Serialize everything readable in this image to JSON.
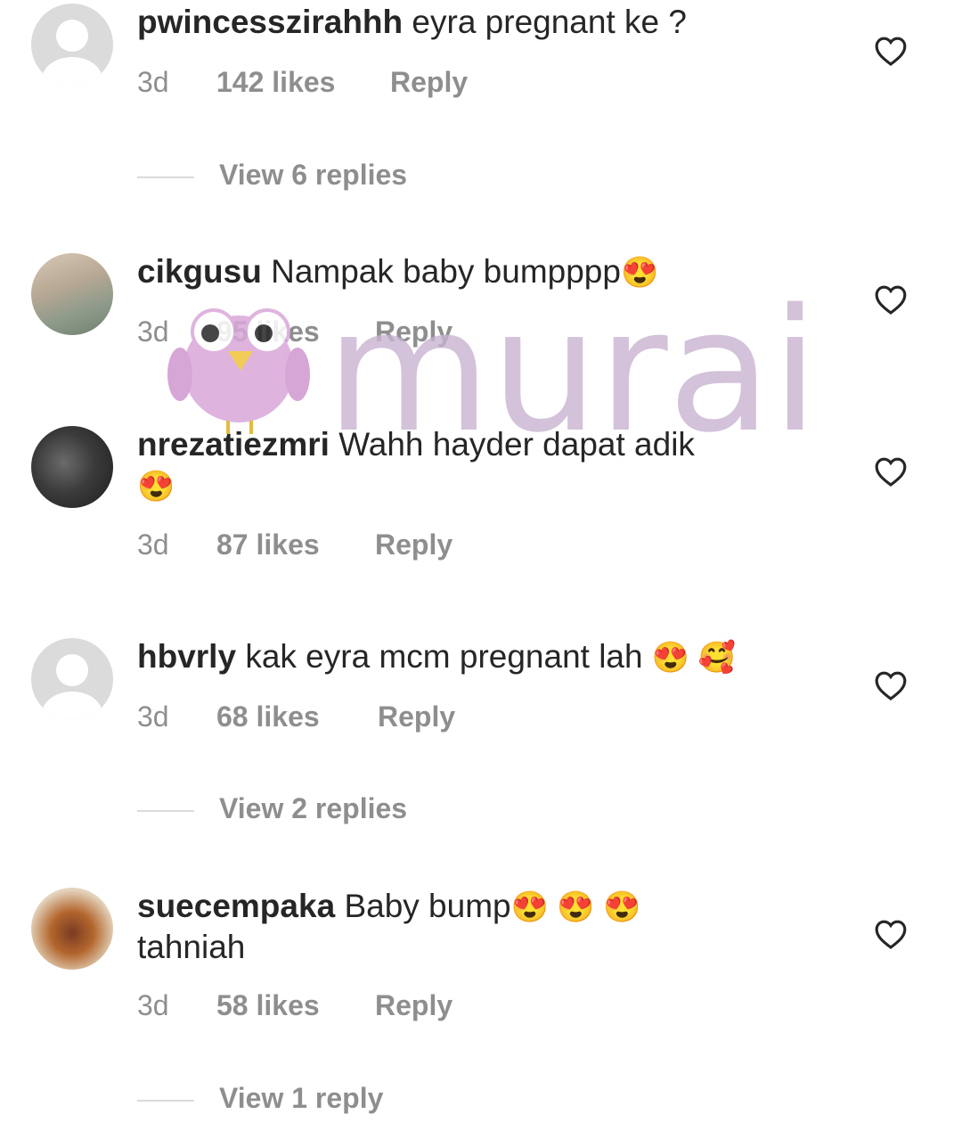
{
  "comments": [
    {
      "username": "pwincesszirahhh",
      "text": "eyra pregnant ke ?",
      "text2": "",
      "emoji": "",
      "time": "3d",
      "likes": "142 likes",
      "reply": "Reply",
      "view_replies": "View 6 replies"
    },
    {
      "username": "cikgusu",
      "text": "Nampak baby bumpppp",
      "text2": "",
      "emoji": "😍",
      "time": "3d",
      "likes": "95 likes",
      "reply": "Reply",
      "view_replies": ""
    },
    {
      "username": "nrezatiezmri",
      "text": "Wahh hayder dapat adik",
      "text2": "",
      "emoji": "😍",
      "time": "3d",
      "likes": "87 likes",
      "reply": "Reply",
      "view_replies": ""
    },
    {
      "username": "hbvrly",
      "text": "kak eyra mcm pregnant lah",
      "text2": "",
      "emoji": "😍 🥰",
      "time": "3d",
      "likes": "68 likes",
      "reply": "Reply",
      "view_replies": "View 2 replies"
    },
    {
      "username": "suecempaka",
      "text": "Baby bump",
      "text2": "tahniah",
      "emoji": "😍 😍 😍",
      "time": "3d",
      "likes": "58 likes",
      "reply": "Reply",
      "view_replies": "View 1 reply"
    }
  ],
  "watermark": {
    "brand": "murai",
    "color": "#c9b3d2",
    "mascot_color": "#d9a8d9"
  },
  "icons": {
    "like": "heart-outline-icon",
    "default_avatar": "default-avatar-icon"
  }
}
